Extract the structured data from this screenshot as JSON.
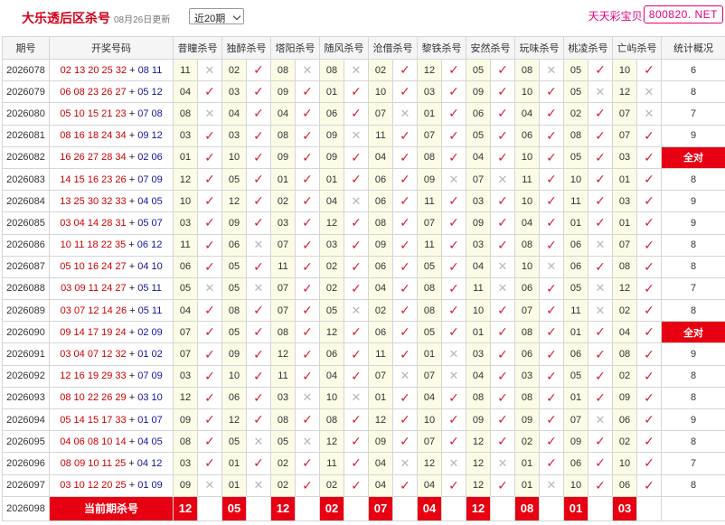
{
  "header": {
    "title": "大乐透后区杀号",
    "updated": "08月26日更新",
    "period_select": "近20期",
    "brand": "天天彩宝贝,",
    "site": "800820. NET"
  },
  "columns": [
    "期号",
    "开奖号码",
    "昔瞳杀号",
    "独醉杀号",
    "塔阳杀号",
    "随风杀号",
    "沧借杀号",
    "黎铁杀号",
    "安然杀号",
    "玩味杀号",
    "桃凌杀号",
    "亡屿杀号",
    "统计概况"
  ],
  "rows": [
    {
      "period": "2026078",
      "front": "02 13 20 25 32",
      "back": "08 11",
      "kills": [
        [
          "11",
          "n"
        ],
        [
          "02",
          "y"
        ],
        [
          "08",
          "n"
        ],
        [
          "08",
          "n"
        ],
        [
          "02",
          "y"
        ],
        [
          "12",
          "y"
        ],
        [
          "05",
          "y"
        ],
        [
          "08",
          "n"
        ],
        [
          "05",
          "y"
        ],
        [
          "10",
          "y"
        ]
      ],
      "stat": "6"
    },
    {
      "period": "2026079",
      "front": "06 08 23 26 27",
      "back": "05 12",
      "kills": [
        [
          "04",
          "y"
        ],
        [
          "03",
          "y"
        ],
        [
          "09",
          "y"
        ],
        [
          "01",
          "y"
        ],
        [
          "10",
          "y"
        ],
        [
          "03",
          "y"
        ],
        [
          "09",
          "y"
        ],
        [
          "10",
          "y"
        ],
        [
          "05",
          "n"
        ],
        [
          "12",
          "n"
        ]
      ],
      "stat": "8"
    },
    {
      "period": "2026080",
      "front": "05 10 15 21 23",
      "back": "07 08",
      "kills": [
        [
          "08",
          "n"
        ],
        [
          "04",
          "y"
        ],
        [
          "04",
          "y"
        ],
        [
          "06",
          "y"
        ],
        [
          "07",
          "n"
        ],
        [
          "01",
          "y"
        ],
        [
          "06",
          "y"
        ],
        [
          "04",
          "y"
        ],
        [
          "02",
          "y"
        ],
        [
          "07",
          "n"
        ]
      ],
      "stat": "7"
    },
    {
      "period": "2026081",
      "front": "08 16 18 24 34",
      "back": "09 12",
      "kills": [
        [
          "03",
          "y"
        ],
        [
          "03",
          "y"
        ],
        [
          "08",
          "y"
        ],
        [
          "09",
          "n"
        ],
        [
          "11",
          "y"
        ],
        [
          "07",
          "y"
        ],
        [
          "05",
          "y"
        ],
        [
          "06",
          "y"
        ],
        [
          "08",
          "y"
        ],
        [
          "07",
          "y"
        ]
      ],
      "stat": "9"
    },
    {
      "period": "2026082",
      "front": "16 26 27 28 34",
      "back": "02 06",
      "kills": [
        [
          "01",
          "y"
        ],
        [
          "10",
          "y"
        ],
        [
          "09",
          "y"
        ],
        [
          "09",
          "y"
        ],
        [
          "04",
          "y"
        ],
        [
          "08",
          "y"
        ],
        [
          "04",
          "y"
        ],
        [
          "10",
          "y"
        ],
        [
          "05",
          "y"
        ],
        [
          "03",
          "y"
        ]
      ],
      "stat": "全对"
    },
    {
      "period": "2026083",
      "front": "14 15 16 23 26",
      "back": "07 09",
      "kills": [
        [
          "12",
          "y"
        ],
        [
          "05",
          "y"
        ],
        [
          "01",
          "y"
        ],
        [
          "01",
          "y"
        ],
        [
          "06",
          "y"
        ],
        [
          "09",
          "n"
        ],
        [
          "07",
          "n"
        ],
        [
          "11",
          "y"
        ],
        [
          "10",
          "y"
        ],
        [
          "01",
          "y"
        ]
      ],
      "stat": "8"
    },
    {
      "period": "2026084",
      "front": "13 25 30 32 33",
      "back": "04 05",
      "kills": [
        [
          "10",
          "y"
        ],
        [
          "12",
          "y"
        ],
        [
          "02",
          "y"
        ],
        [
          "04",
          "n"
        ],
        [
          "06",
          "y"
        ],
        [
          "11",
          "y"
        ],
        [
          "03",
          "y"
        ],
        [
          "10",
          "y"
        ],
        [
          "11",
          "y"
        ],
        [
          "03",
          "y"
        ]
      ],
      "stat": "9"
    },
    {
      "period": "2026085",
      "front": "03 04 14 28 31",
      "back": "05 07",
      "kills": [
        [
          "03",
          "y"
        ],
        [
          "09",
          "y"
        ],
        [
          "03",
          "y"
        ],
        [
          "12",
          "y"
        ],
        [
          "08",
          "y"
        ],
        [
          "07",
          "y"
        ],
        [
          "09",
          "y"
        ],
        [
          "04",
          "y"
        ],
        [
          "01",
          "y"
        ],
        [
          "01",
          "y"
        ]
      ],
      "stat": "9"
    },
    {
      "period": "2026086",
      "front": "10 11 18 22 35",
      "back": "06 12",
      "kills": [
        [
          "11",
          "y"
        ],
        [
          "06",
          "n"
        ],
        [
          "07",
          "y"
        ],
        [
          "03",
          "y"
        ],
        [
          "09",
          "y"
        ],
        [
          "11",
          "y"
        ],
        [
          "03",
          "y"
        ],
        [
          "08",
          "y"
        ],
        [
          "06",
          "n"
        ],
        [
          "07",
          "y"
        ]
      ],
      "stat": "8"
    },
    {
      "period": "2026087",
      "front": "05 10 16 24 27",
      "back": "04 10",
      "kills": [
        [
          "06",
          "y"
        ],
        [
          "05",
          "y"
        ],
        [
          "11",
          "y"
        ],
        [
          "02",
          "y"
        ],
        [
          "06",
          "y"
        ],
        [
          "05",
          "y"
        ],
        [
          "04",
          "n"
        ],
        [
          "10",
          "n"
        ],
        [
          "06",
          "y"
        ],
        [
          "08",
          "y"
        ]
      ],
      "stat": "8"
    },
    {
      "period": "2026088",
      "front": "03 09 11 24 27",
      "back": "05 11",
      "kills": [
        [
          "05",
          "n"
        ],
        [
          "05",
          "n"
        ],
        [
          "07",
          "y"
        ],
        [
          "02",
          "y"
        ],
        [
          "04",
          "y"
        ],
        [
          "08",
          "y"
        ],
        [
          "11",
          "n"
        ],
        [
          "06",
          "y"
        ],
        [
          "05",
          "n"
        ],
        [
          "12",
          "y"
        ]
      ],
      "stat": "7"
    },
    {
      "period": "2026089",
      "front": "03 07 12 14 26",
      "back": "05 11",
      "kills": [
        [
          "04",
          "y"
        ],
        [
          "08",
          "y"
        ],
        [
          "07",
          "y"
        ],
        [
          "05",
          "n"
        ],
        [
          "02",
          "y"
        ],
        [
          "08",
          "y"
        ],
        [
          "10",
          "y"
        ],
        [
          "07",
          "y"
        ],
        [
          "11",
          "n"
        ],
        [
          "02",
          "y"
        ]
      ],
      "stat": "8"
    },
    {
      "period": "2026090",
      "front": "09 14 17 19 24",
      "back": "02 09",
      "kills": [
        [
          "07",
          "y"
        ],
        [
          "05",
          "y"
        ],
        [
          "08",
          "y"
        ],
        [
          "12",
          "y"
        ],
        [
          "06",
          "y"
        ],
        [
          "05",
          "y"
        ],
        [
          "01",
          "y"
        ],
        [
          "08",
          "y"
        ],
        [
          "01",
          "y"
        ],
        [
          "04",
          "y"
        ]
      ],
      "stat": "全对"
    },
    {
      "period": "2026091",
      "front": "03 04 07 12 32",
      "back": "01 02",
      "kills": [
        [
          "07",
          "y"
        ],
        [
          "09",
          "y"
        ],
        [
          "12",
          "y"
        ],
        [
          "06",
          "y"
        ],
        [
          "11",
          "y"
        ],
        [
          "01",
          "n"
        ],
        [
          "03",
          "y"
        ],
        [
          "06",
          "y"
        ],
        [
          "06",
          "y"
        ],
        [
          "08",
          "y"
        ]
      ],
      "stat": "9"
    },
    {
      "period": "2026092",
      "front": "12 16 19 29 33",
      "back": "07 09",
      "kills": [
        [
          "03",
          "y"
        ],
        [
          "10",
          "y"
        ],
        [
          "11",
          "y"
        ],
        [
          "04",
          "y"
        ],
        [
          "07",
          "n"
        ],
        [
          "07",
          "n"
        ],
        [
          "04",
          "y"
        ],
        [
          "03",
          "y"
        ],
        [
          "05",
          "y"
        ],
        [
          "02",
          "y"
        ]
      ],
      "stat": "8"
    },
    {
      "period": "2026093",
      "front": "08 10 22 26 29",
      "back": "03 10",
      "kills": [
        [
          "12",
          "y"
        ],
        [
          "06",
          "y"
        ],
        [
          "03",
          "n"
        ],
        [
          "10",
          "n"
        ],
        [
          "01",
          "y"
        ],
        [
          "04",
          "y"
        ],
        [
          "08",
          "y"
        ],
        [
          "08",
          "y"
        ],
        [
          "01",
          "y"
        ],
        [
          "09",
          "y"
        ]
      ],
      "stat": "8"
    },
    {
      "period": "2026094",
      "front": "05 14 15 17 33",
      "back": "01 07",
      "kills": [
        [
          "09",
          "y"
        ],
        [
          "12",
          "y"
        ],
        [
          "08",
          "y"
        ],
        [
          "08",
          "y"
        ],
        [
          "12",
          "y"
        ],
        [
          "10",
          "y"
        ],
        [
          "09",
          "y"
        ],
        [
          "09",
          "y"
        ],
        [
          "07",
          "n"
        ],
        [
          "06",
          "y"
        ]
      ],
      "stat": "9"
    },
    {
      "period": "2026095",
      "front": "04 06 08 10 14",
      "back": "04 05",
      "kills": [
        [
          "08",
          "y"
        ],
        [
          "05",
          "n"
        ],
        [
          "05",
          "n"
        ],
        [
          "12",
          "y"
        ],
        [
          "09",
          "y"
        ],
        [
          "07",
          "y"
        ],
        [
          "12",
          "y"
        ],
        [
          "02",
          "y"
        ],
        [
          "09",
          "y"
        ],
        [
          "02",
          "y"
        ]
      ],
      "stat": "8"
    },
    {
      "period": "2026096",
      "front": "08 09 10 11 25",
      "back": "04 12",
      "kills": [
        [
          "03",
          "y"
        ],
        [
          "01",
          "y"
        ],
        [
          "02",
          "y"
        ],
        [
          "11",
          "y"
        ],
        [
          "04",
          "n"
        ],
        [
          "12",
          "n"
        ],
        [
          "12",
          "n"
        ],
        [
          "01",
          "y"
        ],
        [
          "06",
          "y"
        ],
        [
          "10",
          "y"
        ]
      ],
      "stat": "7"
    },
    {
      "period": "2026097",
      "front": "03 10 12 20 25",
      "back": "01 09",
      "kills": [
        [
          "09",
          "n"
        ],
        [
          "01",
          "n"
        ],
        [
          "02",
          "y"
        ],
        [
          "02",
          "y"
        ],
        [
          "04",
          "y"
        ],
        [
          "04",
          "y"
        ],
        [
          "12",
          "y"
        ],
        [
          "01",
          "n"
        ],
        [
          "10",
          "y"
        ],
        [
          "06",
          "y"
        ]
      ],
      "stat": "8"
    }
  ],
  "current": {
    "period": "2026098",
    "label": "当前期杀号",
    "kills": [
      "12",
      "05",
      "12",
      "02",
      "07",
      "04",
      "12",
      "08",
      "01",
      "03"
    ]
  },
  "marks": {
    "yes": "✓",
    "no": "✕"
  },
  "colors": {
    "accent_red": "#e60012",
    "front_red": "#c00",
    "back_blue": "#14149a",
    "brand_pink": "#e4007f"
  }
}
